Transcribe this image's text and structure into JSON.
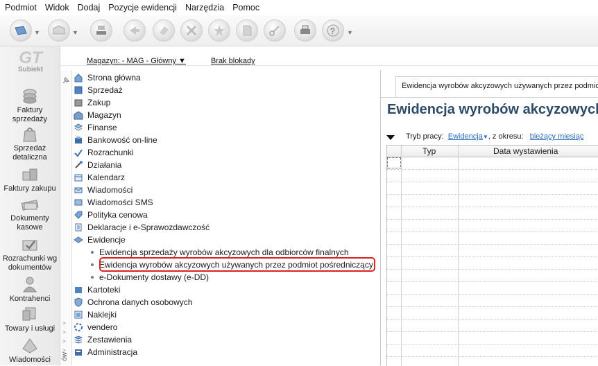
{
  "menu": [
    "Podmiot",
    "Widok",
    "Dodaj",
    "Pozycje ewidencji",
    "Narzędzia",
    "Pomoc"
  ],
  "logo": {
    "mark": "GT",
    "name": "Subiekt"
  },
  "sidebar": [
    {
      "label": "Faktury sprzedaży",
      "icon": "coins-icon"
    },
    {
      "label": "Sprzedaż detaliczna",
      "icon": "bag-icon"
    },
    {
      "label": "Faktury zakupu",
      "icon": "boxes-icon"
    },
    {
      "label": "Dokumenty kasowe",
      "icon": "cash-icon"
    },
    {
      "label": "Rozrachunki wg dokumentów",
      "icon": "check-doc-icon"
    },
    {
      "label": "Kontrahenci",
      "icon": "person-icon"
    },
    {
      "label": "Towary i usługi",
      "icon": "cart-icon"
    },
    {
      "label": "Wiadomości",
      "icon": "message-icon"
    }
  ],
  "strip": {
    "warehouse": "Magazyn: - MAG - Główny",
    "lock": "Brak blokady"
  },
  "tree": [
    {
      "label": "Strona główna",
      "icon": "home-icon"
    },
    {
      "label": "Sprzedaż",
      "icon": "sales-icon"
    },
    {
      "label": "Zakup",
      "icon": "purchase-icon"
    },
    {
      "label": "Magazyn",
      "icon": "warehouse-icon"
    },
    {
      "label": "Finanse",
      "icon": "finance-icon"
    },
    {
      "label": "Bankowość on-line",
      "icon": "bank-icon"
    },
    {
      "label": "Rozrachunki",
      "icon": "settlements-icon"
    },
    {
      "label": "Działania",
      "icon": "actions-icon"
    },
    {
      "label": "Kalendarz",
      "icon": "calendar-icon"
    },
    {
      "label": "Wiadomości",
      "icon": "messages-icon"
    },
    {
      "label": "Wiadomości SMS",
      "icon": "sms-icon"
    },
    {
      "label": "Polityka cenowa",
      "icon": "price-icon"
    },
    {
      "label": "Deklaracje i e-Sprawozdawczość",
      "icon": "declarations-icon"
    },
    {
      "label": "Ewidencje",
      "icon": "records-icon"
    }
  ],
  "tree_sub": [
    "Ewidencja sprzedaży wyrobów akcyzowych dla odbiorców finalnych",
    "Ewidencja wyrobów akcyzowych używanych przez podmiot pośredniczący",
    "e-Dokumenty dostawy (e-DD)"
  ],
  "tree_after": [
    {
      "label": "Kartoteki",
      "icon": "files-icon"
    },
    {
      "label": "Ochrona danych osobowych",
      "icon": "shield-icon"
    },
    {
      "label": "Naklejki",
      "icon": "labels-icon"
    },
    {
      "label": "vendero",
      "icon": "vendero-icon"
    },
    {
      "label": "Zestawienia",
      "icon": "reports-icon"
    },
    {
      "label": "Administracja",
      "icon": "admin-icon"
    }
  ],
  "side_vertical_label": "ów",
  "tab": {
    "label": "Ewidencja wyrobów akcyzowych używanych przez podmiot pośredniczący"
  },
  "page_title": "Ewidencja wyrobów akcyzowych używanych przez podmiot pośredniczący",
  "filters": {
    "mode_label": "Tryb pracy:",
    "mode_value": "Ewidencja",
    "period_label": ", z okresu:",
    "period_value": "bieżący miesiąc"
  },
  "grid": {
    "columns": [
      "Typ",
      "Data wystawienia"
    ]
  }
}
